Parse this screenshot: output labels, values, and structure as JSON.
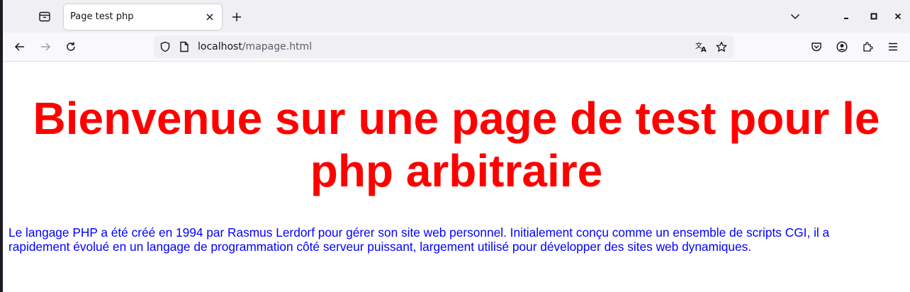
{
  "browser": {
    "tab": {
      "title": "Page test php"
    },
    "url": {
      "host": "localhost",
      "path": "/mapage.html"
    }
  },
  "icons": {
    "tab_overview": "firefox-view-icon",
    "close": "close-icon",
    "new_tab": "plus-icon",
    "list_all_tabs": "chevron-down-icon",
    "minimize": "minimize-icon",
    "maximize": "maximize-icon",
    "window_close": "close-icon",
    "back": "back-arrow-icon",
    "forward": "forward-arrow-icon",
    "reload": "reload-icon",
    "tracking_protection": "shield-icon",
    "page_info": "page-icon",
    "translate": "translate-icon",
    "bookmark": "star-icon",
    "pocket": "pocket-icon",
    "account": "account-icon",
    "extensions": "extensions-icon",
    "menu": "hamburger-menu-icon"
  },
  "page": {
    "heading": "Bienvenue sur une page de test pour le php arbitraire",
    "paragraph": "Le langage PHP a été créé en 1994 par Rasmus Lerdorf pour gérer son site web personnel. Initialement conçu comme un ensemble de scripts CGI, il a rapidement évolué en un langage de programmation côté serveur puissant, largement utilisé pour développer des sites web dynamiques."
  },
  "colors": {
    "heading": "#ff0000",
    "paragraph": "#0000ff",
    "tabbar_bg": "#f0f0f4",
    "toolbar_bg": "#f9f9fb"
  }
}
